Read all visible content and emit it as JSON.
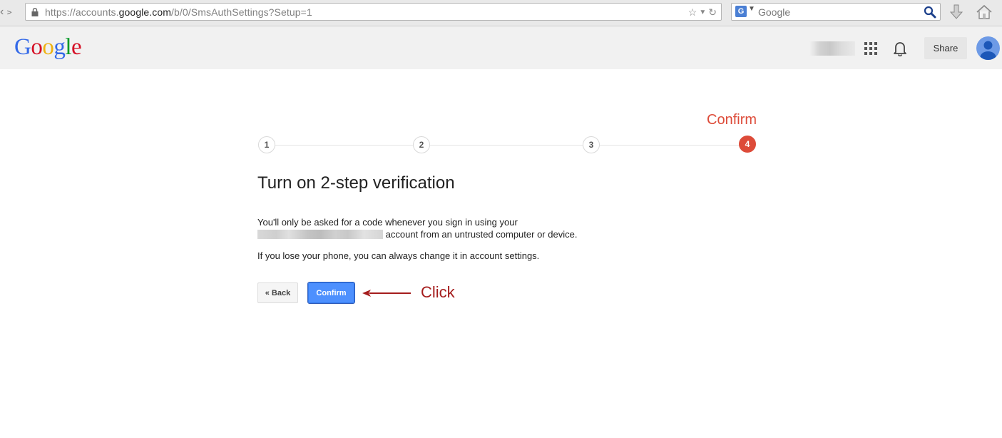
{
  "browser": {
    "url_prefix": "https://accounts.",
    "url_host": "google.com",
    "url_path": "/b/0/SmsAuthSettings?Setup=1",
    "search_placeholder": "Google",
    "search_engine_icon": "G"
  },
  "header": {
    "logo_letters": [
      {
        "char": "G",
        "color": "#3369e8"
      },
      {
        "char": "o",
        "color": "#d50f25"
      },
      {
        "char": "o",
        "color": "#eeb211"
      },
      {
        "char": "g",
        "color": "#3369e8"
      },
      {
        "char": "l",
        "color": "#009925"
      },
      {
        "char": "e",
        "color": "#d50f25"
      }
    ],
    "share_label": "Share"
  },
  "stepper": {
    "current_label": "Confirm",
    "steps": [
      "1",
      "2",
      "3",
      "4"
    ],
    "active_step": 4,
    "active_color": "#dd4b39"
  },
  "content": {
    "title": "Turn on 2-step verification",
    "para1_line1": "You'll only be asked for a code whenever you sign in using your",
    "para1_line2": "account from an untrusted computer or device.",
    "para2": "If you lose your phone, you can always change it in account settings."
  },
  "actions": {
    "back_label": "« Back",
    "confirm_label": "Confirm",
    "confirm_color": "#4d90fe"
  },
  "annotation": {
    "text": "Click",
    "color": "#a51d1d"
  }
}
